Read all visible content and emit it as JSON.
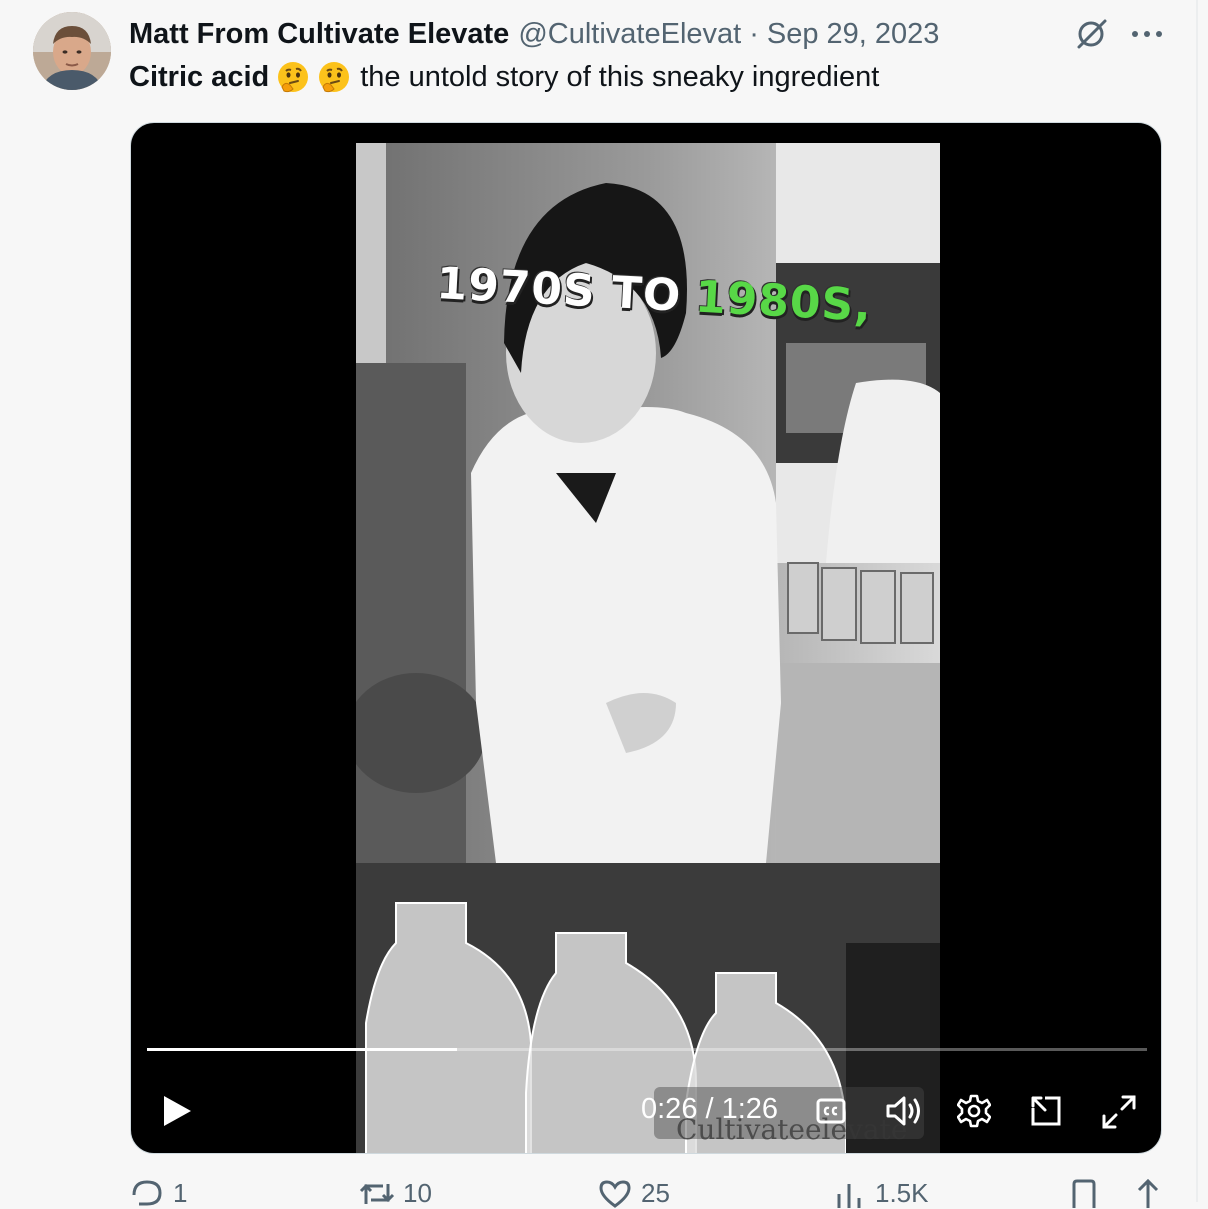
{
  "tweet": {
    "author_name": "Matt From Cultivate Elevate",
    "handle": "@CultivateElevat",
    "separator": "·",
    "date": "Sep 29, 2023",
    "text_bold": "Citric acid",
    "emojis": [
      "thinking-face",
      "thinking-face"
    ],
    "text_rest": "the untold story of this sneaky ingredient"
  },
  "video": {
    "caption_part1": "1970S TO",
    "caption_part2": "1980S,",
    "caption_accent_color": "#58d847",
    "watermark": "Cultivateelevate",
    "current_time": "0:26",
    "duration": "1:26",
    "time_display": "0:26 / 1:26",
    "progress_fraction": 0.31,
    "controls": [
      "play-icon",
      "captions-icon",
      "volume-icon",
      "settings-icon",
      "pop-out-icon",
      "fullscreen-icon"
    ]
  },
  "actions": {
    "replies": "1",
    "reposts": "10",
    "likes": "25",
    "views": "1.5K"
  },
  "colors": {
    "text_primary": "#0f1419",
    "text_secondary": "#536471",
    "page_bg": "#f7f7f7",
    "media_bg": "#000000"
  }
}
